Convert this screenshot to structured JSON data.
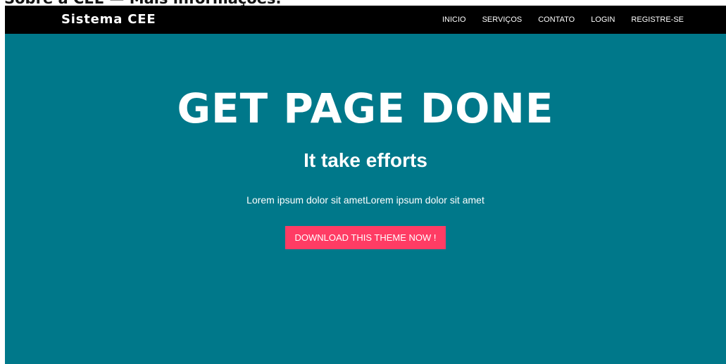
{
  "browser_overlay": {
    "clipped_text": "Sobre a CEE — Mais informações."
  },
  "navbar": {
    "brand": "Sistema CEE",
    "items": [
      {
        "label": "INICIO"
      },
      {
        "label": "SERVIÇOS"
      },
      {
        "label": "CONTATO"
      },
      {
        "label": "LOGIN"
      },
      {
        "label": "REGISTRE-SE"
      }
    ]
  },
  "hero": {
    "title": "GET PAGE DONE",
    "subtitle": "It take efforts",
    "text": "Lorem ipsum dolor sit ametLorem ipsum dolor sit amet",
    "cta_label": "DOWNLOAD THIS THEME NOW !"
  },
  "colors": {
    "hero_bg": "#00788a",
    "navbar_bg": "#000000",
    "cta_bg": "#ff3c64",
    "text": "#ffffff"
  }
}
